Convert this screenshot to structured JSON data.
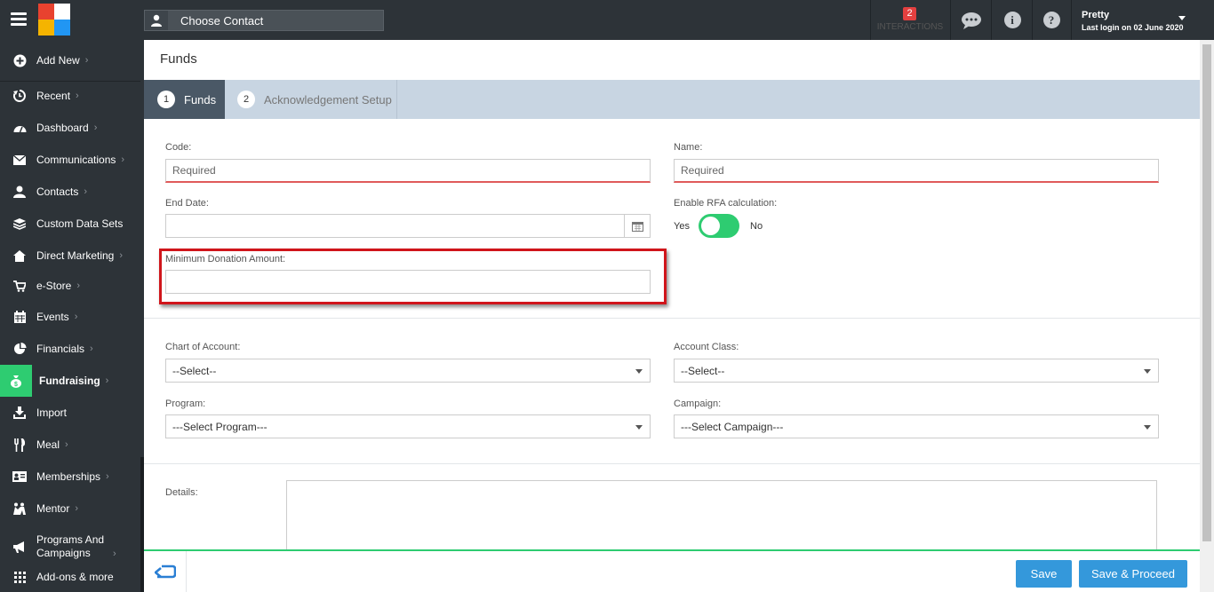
{
  "topbar": {
    "choose_contact": "Choose Contact",
    "interactions_count": "2",
    "interactions_label": "INTERACTIONS",
    "user_name": "Pretty",
    "last_login": "Last login on 02 June 2020"
  },
  "sidebar": {
    "items": [
      {
        "label": "Add New",
        "icon": "plus-circle-icon"
      },
      {
        "label": "Recent",
        "icon": "history-icon"
      },
      {
        "label": "Dashboard",
        "icon": "dashboard-icon"
      },
      {
        "label": "Communications",
        "icon": "envelope-icon"
      },
      {
        "label": "Contacts",
        "icon": "user-icon"
      },
      {
        "label": "Custom Data Sets",
        "icon": "layers-icon"
      },
      {
        "label": "Direct Marketing",
        "icon": "home-icon"
      },
      {
        "label": "e-Store",
        "icon": "cart-icon"
      },
      {
        "label": "Events",
        "icon": "calendar-icon"
      },
      {
        "label": "Financials",
        "icon": "chart-icon"
      },
      {
        "label": "Fundraising",
        "icon": "money-bag-icon"
      },
      {
        "label": "Import",
        "icon": "import-icon"
      },
      {
        "label": "Meal",
        "icon": "utensils-icon"
      },
      {
        "label": "Memberships",
        "icon": "id-card-icon"
      },
      {
        "label": "Mentor",
        "icon": "mentor-icon"
      },
      {
        "label": "Programs And Campaigns",
        "icon": "megaphone-icon"
      },
      {
        "label": "Add-ons & more",
        "icon": "grid-icon"
      }
    ],
    "chevron": "›"
  },
  "page": {
    "title": "Funds",
    "steps": [
      {
        "num": "1",
        "label": "Funds"
      },
      {
        "num": "2",
        "label": "Acknowledgement Setup"
      }
    ]
  },
  "form": {
    "code_label": "Code:",
    "code_placeholder": "Required",
    "name_label": "Name:",
    "name_placeholder": "Required",
    "end_date_label": "End Date:",
    "rfa_label": "Enable RFA calculation:",
    "rfa_yes": "Yes",
    "rfa_no": "No",
    "rfa_enabled": true,
    "min_donation_label": "Minimum Donation Amount:",
    "chart_of_account_label": "Chart of Account:",
    "chart_of_account_value": "--Select--",
    "account_class_label": "Account Class:",
    "account_class_value": "--Select--",
    "program_label": "Program:",
    "program_value": "---Select Program---",
    "campaign_label": "Campaign:",
    "campaign_value": "---Select Campaign---",
    "details_label": "Details:"
  },
  "footer": {
    "save": "Save",
    "save_proceed": "Save & Proceed"
  },
  "colors": {
    "accent_green": "#2ecc71",
    "button_blue": "#3498db",
    "highlight_red": "#d0151b",
    "dark_bg": "#2d3338"
  }
}
